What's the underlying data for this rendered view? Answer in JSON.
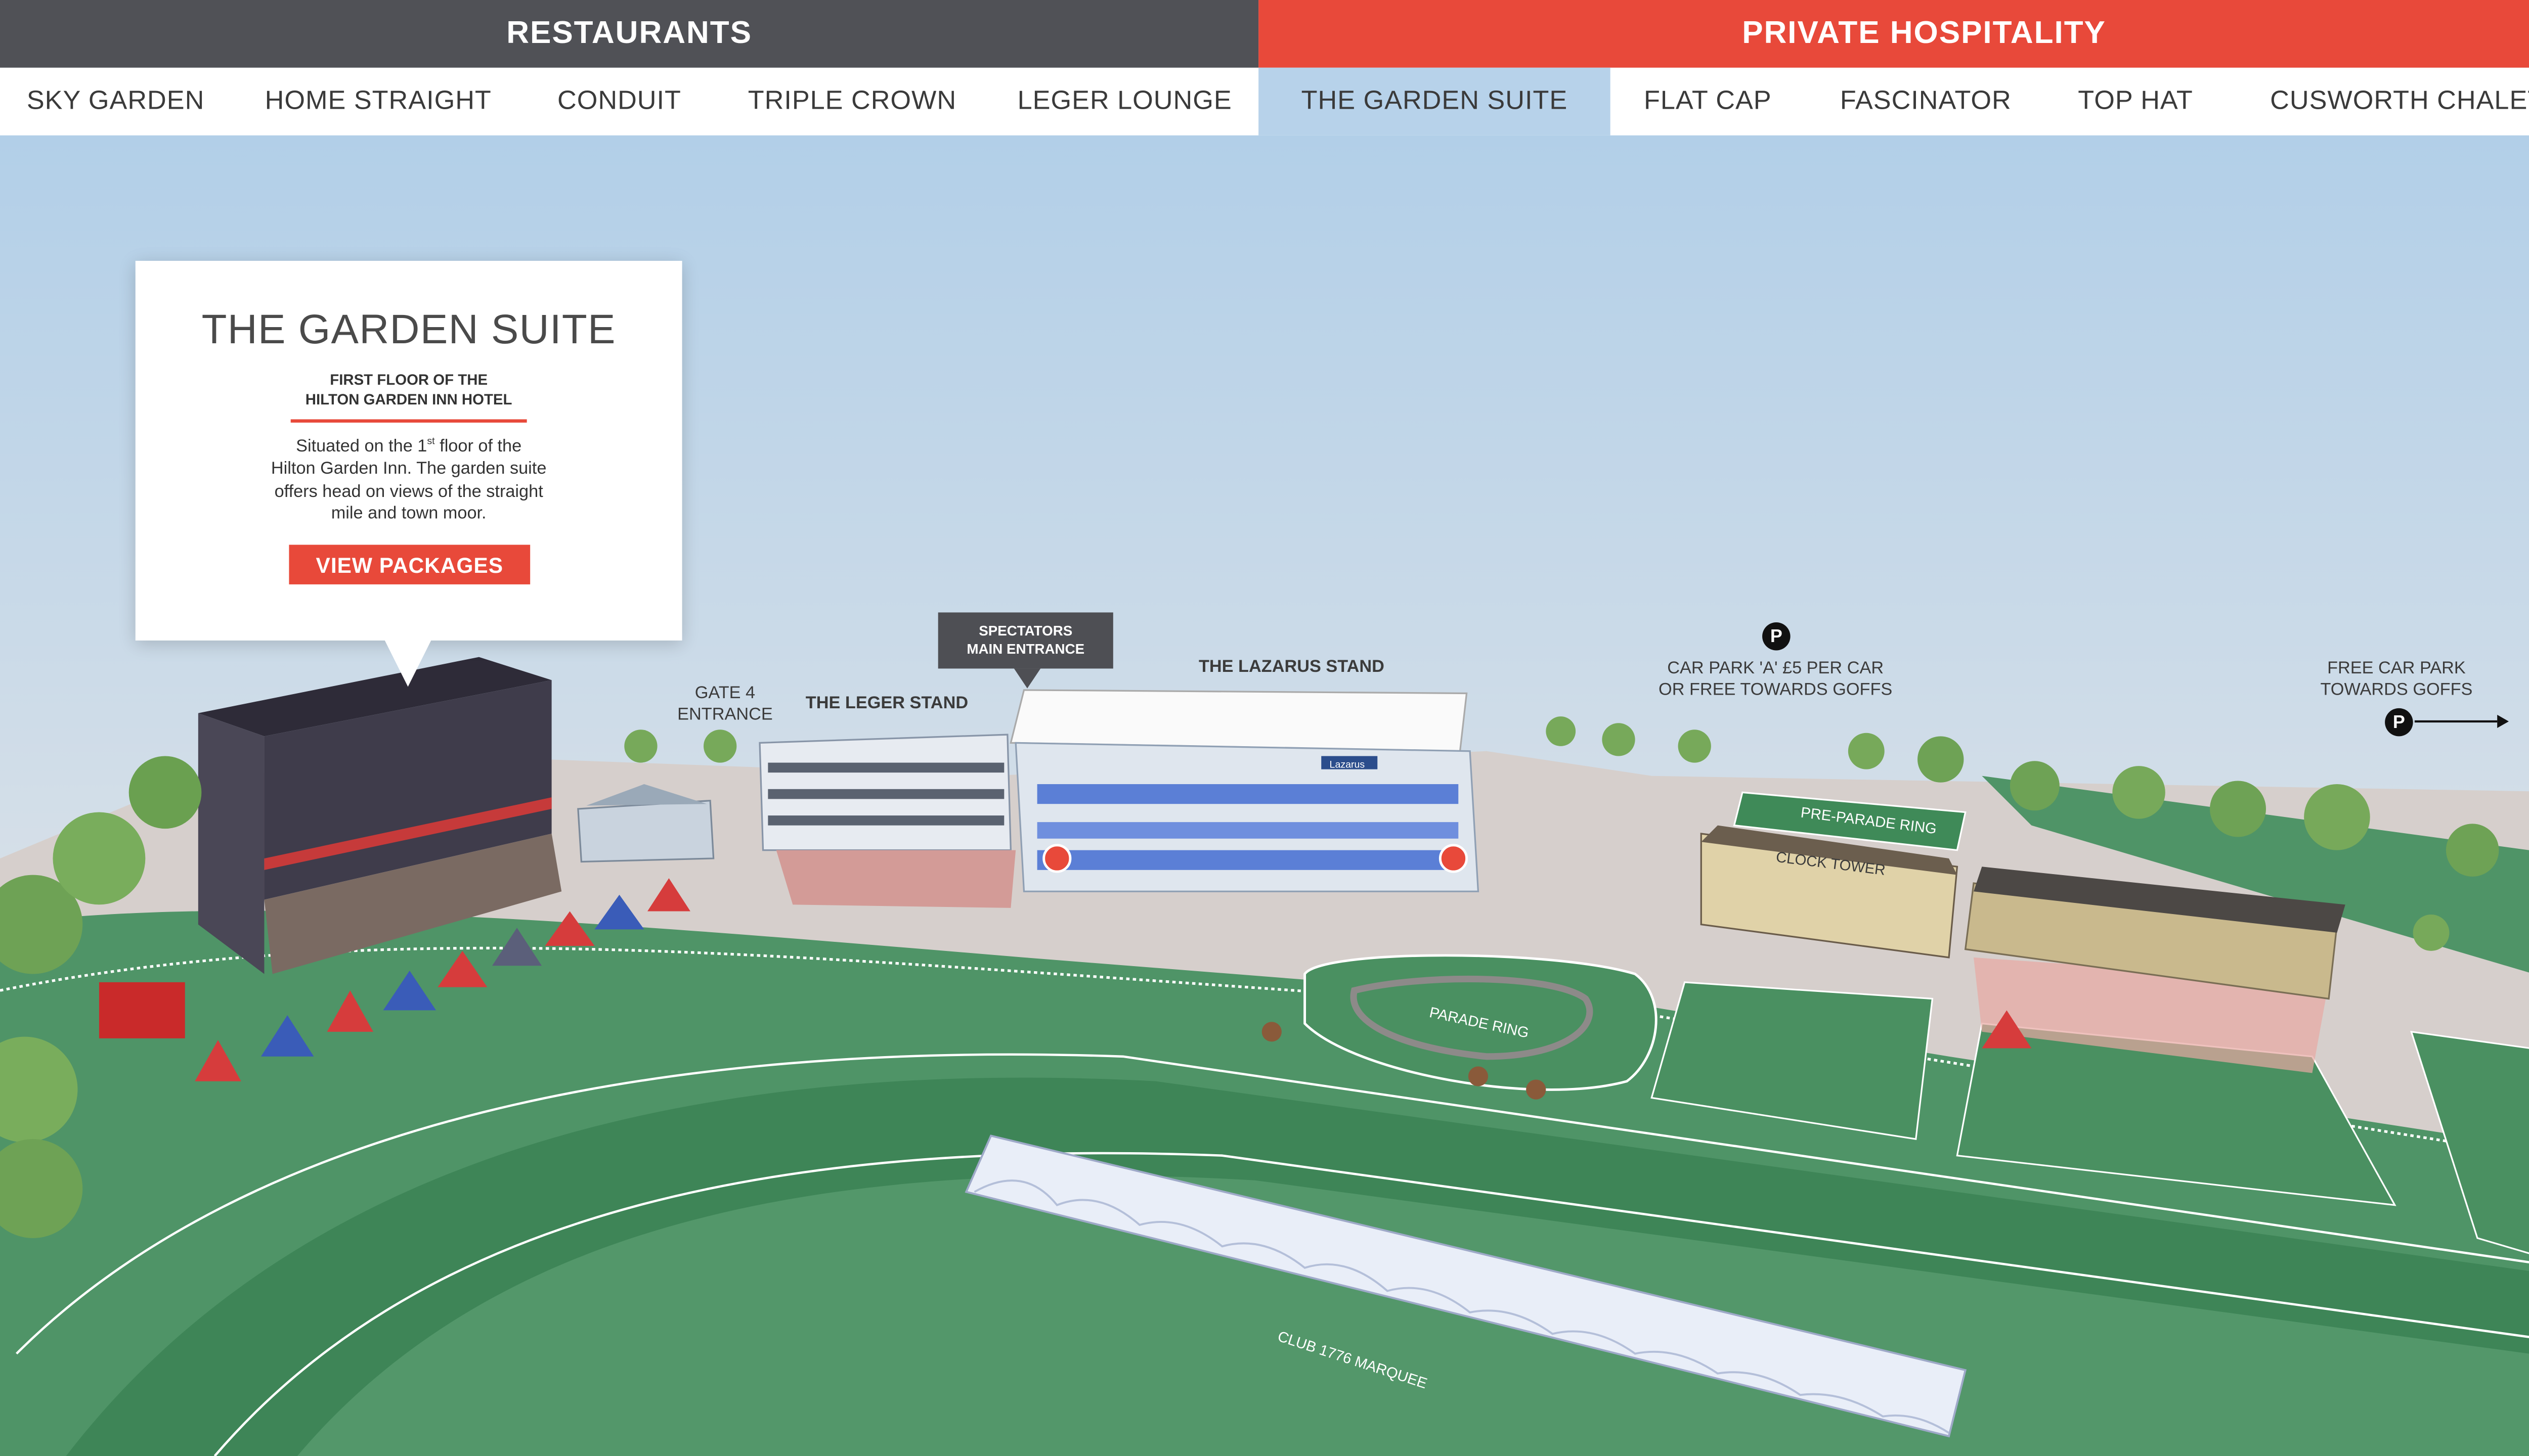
{
  "nav": {
    "categories": [
      {
        "label": "RESTAURANTS",
        "color": "#505156"
      },
      {
        "label": "PRIVATE HOSPITALITY",
        "color": "#e8493a"
      }
    ],
    "restaurants": [
      "SKY GARDEN",
      "HOME STRAIGHT",
      "CONDUIT",
      "TRIPLE CROWN",
      "LEGER LOUNGE"
    ],
    "hospitality": [
      "THE GARDEN SUITE",
      "FLAT CAP",
      "FASCINATOR",
      "TOP HAT",
      "CUSWORTH CHALET"
    ],
    "active_tab": "THE GARDEN SUITE"
  },
  "card": {
    "title": "THE GARDEN SUITE",
    "subtitle_line1": "FIRST FLOOR OF THE",
    "subtitle_line2": "HILTON GARDEN INN HOTEL",
    "desc_line1_pre": "Situated on the 1",
    "desc_line1_sup": "st",
    "desc_line1_post": " floor of the",
    "desc_line2": "Hilton Garden Inn. The garden suite",
    "desc_line3": "offers head on views of the straight",
    "desc_line4": "mile and town moor.",
    "button_label": "VIEW PACKAGES"
  },
  "map": {
    "entrance_line1": "SPECTATORS",
    "entrance_line2": "MAIN ENTRANCE",
    "gate4_line1": "GATE 4",
    "gate4_line2": "ENTRANCE",
    "leger_stand": "THE LEGER STAND",
    "lazarus_stand": "THE LAZARUS STAND",
    "car_park_a_line1": "CAR PARK 'A' £5 PER CAR",
    "car_park_a_line2": "OR FREE TOWARDS GOFFS",
    "free_car_park_line1": "FREE CAR PARK",
    "free_car_park_line2": "TOWARDS GOFFS",
    "parking_symbol": "P",
    "pre_parade_ring": "PRE-PARADE RING",
    "clock_tower": "CLOCK TOWER",
    "parade_ring": "PARADE RING",
    "club_marquee": "CLUB 1776 MARQUEE",
    "lazarus_sign": "Lazarus",
    "colors": {
      "sky": "#b9d4ea",
      "grass": "#4f9467",
      "track_dark": "#3f7f55",
      "concourse": "#d9d2cf",
      "accent": "#e8493a",
      "hotel": "#3f3c4b"
    }
  }
}
